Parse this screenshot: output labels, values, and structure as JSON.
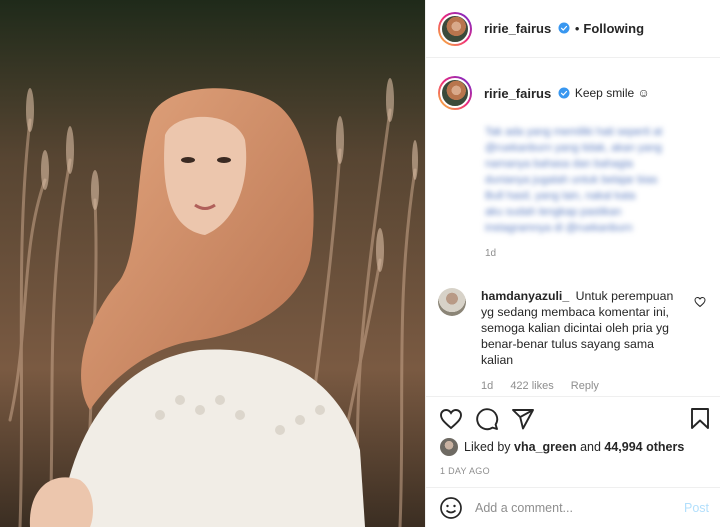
{
  "post": {
    "username": "ririe_fairus",
    "follow_status": "Following",
    "separator": "•",
    "caption": "Keep smile ☺",
    "caption_blurred_lines": [
      "Tak ada yang memiliki hati seperti at",
      "@ruekanburn yang tidak, akan yang",
      "namanya bahasa dan bahagia",
      "dunianya jugalah untuk belajar bias",
      "Bull hasil, yang lain, nakal kata",
      "aku sudah lengkap pastikan",
      "instagramnya di @ruekanburn"
    ],
    "caption_age": "1d"
  },
  "comment": {
    "username": "hamdanyazuli_",
    "text": "Untuk perempuan yg sedang membaca komentar ini, semoga kalian dicintai oleh pria yg benar-benar tulus sayang sama kalian",
    "age": "1d",
    "likes": "422 likes",
    "reply": "Reply"
  },
  "likes": {
    "prefix": "Liked by",
    "user": "vha_green",
    "middle": "and",
    "others": "44,994 others"
  },
  "timestamp": "1 DAY AGO",
  "add_comment": {
    "placeholder": "Add a comment...",
    "post_label": "Post"
  },
  "colors": {
    "verified": "#3897f0",
    "post_disabled": "#b2dffc",
    "meta": "#8e8e8e"
  },
  "icons": [
    "heart-icon",
    "comment-icon",
    "share-icon",
    "bookmark-icon",
    "emoji-icon",
    "verified-icon"
  ]
}
